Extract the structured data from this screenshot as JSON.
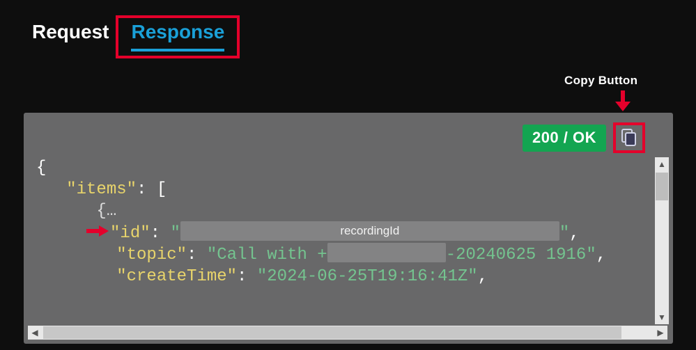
{
  "tabs": {
    "request": "Request",
    "response": "Response"
  },
  "annotations": {
    "copy_label": "Copy Button",
    "recording_id_placeholder": "recordingId"
  },
  "status": {
    "text": "200 / OK",
    "color": "#13a551"
  },
  "code": {
    "open_brace": "{",
    "items_key": "\"items\"",
    "colon_sp": ": ",
    "open_bracket": "[",
    "obj_open_trunc": "{…",
    "id_key": "\"id\"",
    "quote": "\"",
    "comma": ",",
    "topic_key": "\"topic\"",
    "topic_prefix": "\"Call with +",
    "topic_suffix": "-20240625 1916\"",
    "createTime_key": "\"createTime\"",
    "createTime_val": "\"2024-06-25T19:16:41Z\""
  }
}
